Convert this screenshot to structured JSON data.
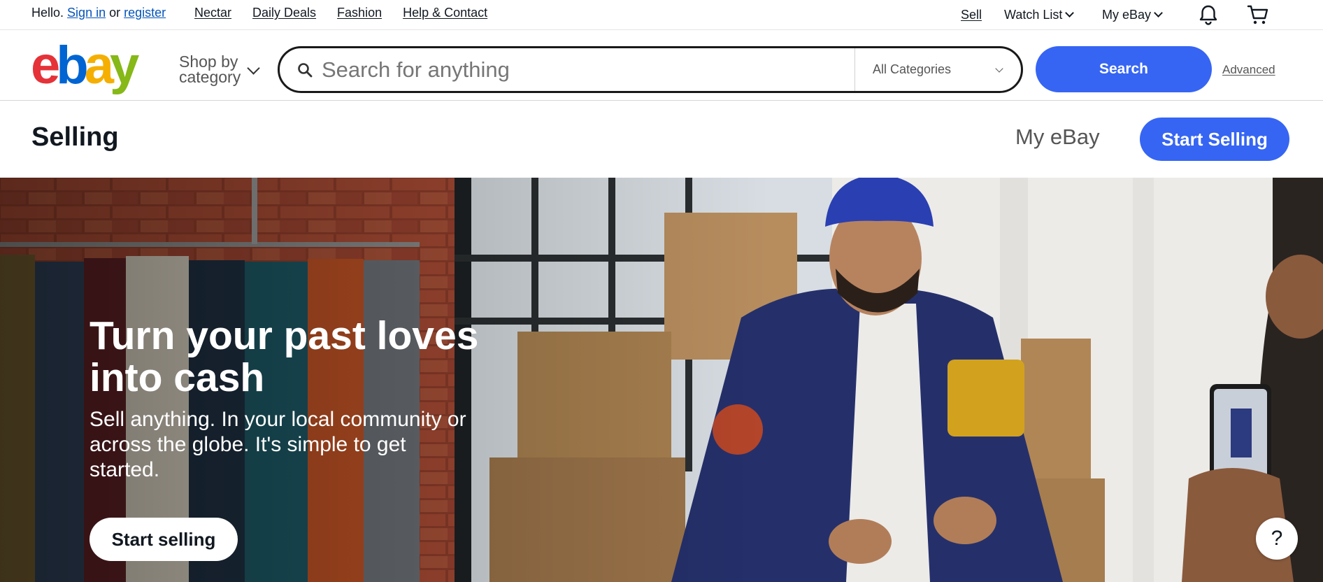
{
  "topbar": {
    "greeting": "Hello.",
    "sign_in": "Sign in",
    "or": "or",
    "register": "register",
    "nav": [
      "Nectar",
      "Daily Deals",
      "Fashion",
      "Help & Contact"
    ],
    "sell": "Sell",
    "watch_list": "Watch List",
    "my_ebay": "My eBay",
    "icons": {
      "notifications": "bell-icon",
      "cart": "cart-icon"
    }
  },
  "header": {
    "logo_text": "ebay",
    "logo_colors": {
      "e": "#e53238",
      "b": "#0064d2",
      "a": "#f5af02",
      "y": "#86b817"
    },
    "shop_by_line1": "Shop by",
    "shop_by_line2": "category",
    "search_placeholder": "Search for anything",
    "category": "All Categories",
    "search_button": "Search",
    "advanced": "Advanced",
    "accent": "#3665f3"
  },
  "selling": {
    "title": "Selling",
    "my_ebay": "My eBay",
    "start_selling": "Start Selling"
  },
  "hero": {
    "headline": "Turn your past loves into cash",
    "subtext": "Sell anything. In your local community or across the globe. It's simple to get started.",
    "cta": "Start selling",
    "help": "?"
  }
}
